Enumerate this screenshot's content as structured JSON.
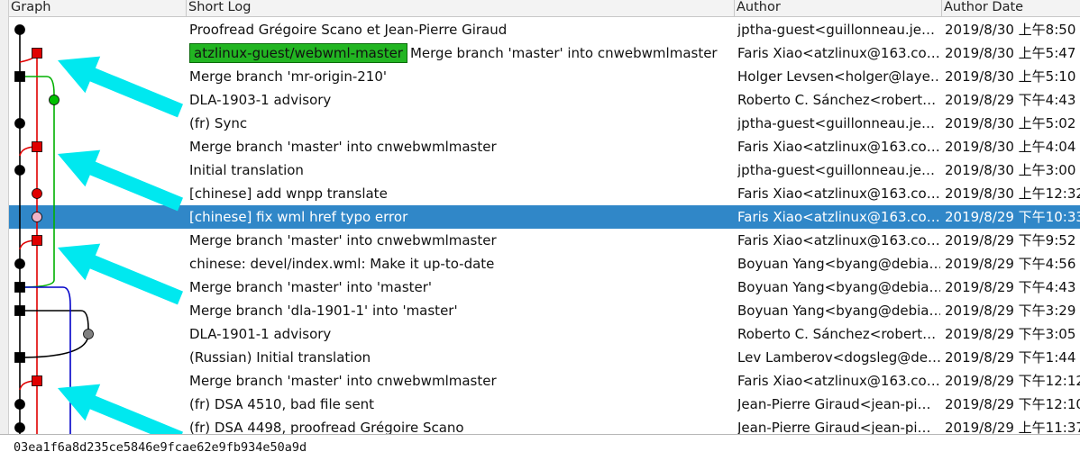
{
  "columns": {
    "graph": "Graph",
    "log": "Short Log",
    "author": "Author",
    "date": "Author Date"
  },
  "commits": [
    {
      "ref": "",
      "message": "Proofread Grégoire Scano et Jean-Pierre Giraud",
      "author": "jptha-guest<guillonneau.je…",
      "date": "2019/8/30 上午8:50",
      "selected": false
    },
    {
      "ref": "atzlinux-guest/webwml-master",
      "message": "Merge branch 'master' into cnwebwmlmaster",
      "author": "Faris Xiao<atzlinux@163.co…",
      "date": "2019/8/30 上午5:47",
      "selected": false
    },
    {
      "ref": "",
      "message": "Merge branch 'mr-origin-210'",
      "author": "Holger Levsen<holger@laye…",
      "date": "2019/8/30 上午5:10",
      "selected": false
    },
    {
      "ref": "",
      "message": "DLA-1903-1 advisory",
      "author": "Roberto C. Sánchez<robert…",
      "date": "2019/8/29 下午4:43",
      "selected": false
    },
    {
      "ref": "",
      "message": "(fr) Sync",
      "author": "jptha-guest<guillonneau.je…",
      "date": "2019/8/30 上午5:02",
      "selected": false
    },
    {
      "ref": "",
      "message": "Merge branch 'master' into cnwebwmlmaster",
      "author": "Faris Xiao<atzlinux@163.co…",
      "date": "2019/8/30 上午4:04",
      "selected": false
    },
    {
      "ref": "",
      "message": "Initial translation",
      "author": "jptha-guest<guillonneau.je…",
      "date": "2019/8/30 上午3:00",
      "selected": false
    },
    {
      "ref": "",
      "message": "[chinese] add wnpp translate",
      "author": "Faris Xiao<atzlinux@163.co…",
      "date": "2019/8/30 上午12:32",
      "selected": false
    },
    {
      "ref": "",
      "message": "[chinese] fix wml href typo error",
      "author": "Faris Xiao<atzlinux@163.co…",
      "date": "2019/8/29 下午10:33",
      "selected": true
    },
    {
      "ref": "",
      "message": "Merge branch 'master' into cnwebwmlmaster",
      "author": "Faris Xiao<atzlinux@163.co…",
      "date": "2019/8/29 下午9:52",
      "selected": false
    },
    {
      "ref": "",
      "message": "chinese: devel/index.wml: Make it up-to-date",
      "author": "Boyuan Yang<byang@debia…",
      "date": "2019/8/29 下午4:56",
      "selected": false
    },
    {
      "ref": "",
      "message": "Merge branch 'master' into 'master'",
      "author": "Boyuan Yang<byang@debia…",
      "date": "2019/8/29 下午4:43",
      "selected": false
    },
    {
      "ref": "",
      "message": "Merge branch 'dla-1901-1' into 'master'",
      "author": "Boyuan Yang<byang@debia…",
      "date": "2019/8/29 下午3:29",
      "selected": false
    },
    {
      "ref": "",
      "message": "DLA-1901-1 advisory",
      "author": "Roberto C. Sánchez<robert…",
      "date": "2019/8/29 下午3:05",
      "selected": false
    },
    {
      "ref": "",
      "message": "(Russian) Initial translation",
      "author": "Lev Lamberov<dogsleg@de…",
      "date": "2019/8/29 下午1:44",
      "selected": false
    },
    {
      "ref": "",
      "message": "Merge branch 'master' into cnwebwmlmaster",
      "author": "Faris Xiao<atzlinux@163.co…",
      "date": "2019/8/29 下午12:12",
      "selected": false
    },
    {
      "ref": "",
      "message": "(fr) DSA 4510, bad file sent",
      "author": "Jean-Pierre Giraud<jean-pi…",
      "date": "2019/8/29 下午12:10",
      "selected": false
    },
    {
      "ref": "",
      "message": "(fr) DSA 4498, proofread Grégoire Scano",
      "author": "Jean-Pierre Giraud<jean-pi…",
      "date": "2019/8/29 上午11:37",
      "selected": false
    }
  ],
  "graph": {
    "lanes": [
      {
        "color": "#000000",
        "from": 0,
        "to": 18
      },
      {
        "color": "#e00000",
        "from": 1,
        "to": 18
      },
      {
        "color": "#00b000",
        "from": 3,
        "to": 11
      },
      {
        "color": "#000000",
        "from": 12,
        "to": 13
      },
      {
        "color": "#0000c8",
        "from": 11,
        "to": 18
      }
    ],
    "nodes": [
      {
        "row": 0,
        "lane": 0,
        "shape": "circle",
        "color": "#000000"
      },
      {
        "row": 1,
        "lane": 1,
        "shape": "square",
        "color": "#e00000"
      },
      {
        "row": 2,
        "lane": 0,
        "shape": "square",
        "color": "#000000"
      },
      {
        "row": 3,
        "lane": 2,
        "shape": "circle",
        "color": "#00c000"
      },
      {
        "row": 4,
        "lane": 0,
        "shape": "circle",
        "color": "#000000"
      },
      {
        "row": 5,
        "lane": 1,
        "shape": "square",
        "color": "#e00000"
      },
      {
        "row": 6,
        "lane": 0,
        "shape": "circle",
        "color": "#000000"
      },
      {
        "row": 7,
        "lane": 1,
        "shape": "circle",
        "color": "#e00000"
      },
      {
        "row": 8,
        "lane": 1,
        "shape": "circle",
        "color": "#f0b4c8"
      },
      {
        "row": 9,
        "lane": 1,
        "shape": "square",
        "color": "#e00000"
      },
      {
        "row": 10,
        "lane": 0,
        "shape": "circle",
        "color": "#000000"
      },
      {
        "row": 11,
        "lane": 0,
        "shape": "square",
        "color": "#000000"
      },
      {
        "row": 12,
        "lane": 0,
        "shape": "square",
        "color": "#000000"
      },
      {
        "row": 13,
        "lane": 3,
        "shape": "circle",
        "color": "#808080"
      },
      {
        "row": 14,
        "lane": 0,
        "shape": "square",
        "color": "#000000"
      },
      {
        "row": 15,
        "lane": 1,
        "shape": "square",
        "color": "#e00000"
      },
      {
        "row": 16,
        "lane": 0,
        "shape": "circle",
        "color": "#000000"
      },
      {
        "row": 17,
        "lane": 0,
        "shape": "circle",
        "color": "#000000"
      }
    ],
    "annotation_color": "#00e8ef",
    "annotation_rows": [
      1,
      5,
      9,
      15
    ]
  },
  "status": {
    "commit_hash": "03ea1f6a8d235ce5846e9fcae62e9fb934e50a9d"
  }
}
